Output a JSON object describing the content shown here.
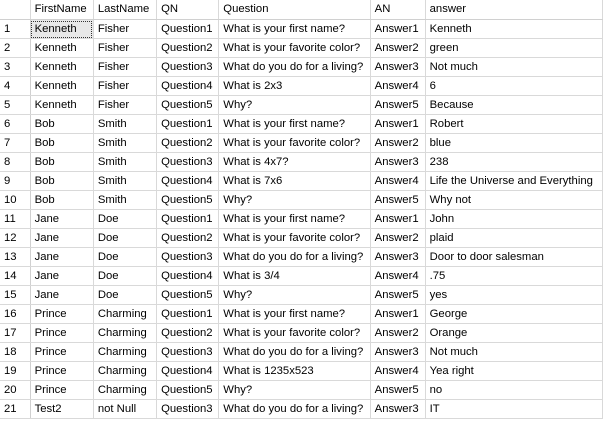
{
  "results_grid": {
    "columns": [
      "FirstName",
      "LastName",
      "QN",
      "Question",
      "AN",
      "answer"
    ],
    "rows": [
      {
        "num": "1",
        "cells": [
          "Kenneth",
          "Fisher",
          "Question1",
          "What is your first name?",
          "Answer1",
          "Kenneth"
        ]
      },
      {
        "num": "2",
        "cells": [
          "Kenneth",
          "Fisher",
          "Question2",
          "What is your favorite color?",
          "Answer2",
          "green"
        ]
      },
      {
        "num": "3",
        "cells": [
          "Kenneth",
          "Fisher",
          "Question3",
          "What do you do for a living?",
          "Answer3",
          "Not much"
        ]
      },
      {
        "num": "4",
        "cells": [
          "Kenneth",
          "Fisher",
          "Question4",
          "What is 2x3",
          "Answer4",
          "6"
        ]
      },
      {
        "num": "5",
        "cells": [
          "Kenneth",
          "Fisher",
          "Question5",
          "Why?",
          "Answer5",
          "Because"
        ]
      },
      {
        "num": "6",
        "cells": [
          "Bob",
          "Smith",
          "Question1",
          "What is your first name?",
          "Answer1",
          "Robert"
        ]
      },
      {
        "num": "7",
        "cells": [
          "Bob",
          "Smith",
          "Question2",
          "What is your favorite color?",
          "Answer2",
          "blue"
        ]
      },
      {
        "num": "8",
        "cells": [
          "Bob",
          "Smith",
          "Question3",
          "What is 4x7?",
          "Answer3",
          "238"
        ]
      },
      {
        "num": "9",
        "cells": [
          "Bob",
          "Smith",
          "Question4",
          "What is 7x6",
          "Answer4",
          "Life the Universe and Everything"
        ]
      },
      {
        "num": "10",
        "cells": [
          "Bob",
          "Smith",
          "Question5",
          "Why?",
          "Answer5",
          "Why not"
        ]
      },
      {
        "num": "11",
        "cells": [
          "Jane",
          "Doe",
          "Question1",
          "What is your first name?",
          "Answer1",
          "John"
        ]
      },
      {
        "num": "12",
        "cells": [
          "Jane",
          "Doe",
          "Question2",
          "What is your favorite color?",
          "Answer2",
          "plaid"
        ]
      },
      {
        "num": "13",
        "cells": [
          "Jane",
          "Doe",
          "Question3",
          "What do you do for a living?",
          "Answer3",
          "Door to door salesman"
        ]
      },
      {
        "num": "14",
        "cells": [
          "Jane",
          "Doe",
          "Question4",
          "What is 3/4",
          "Answer4",
          ".75"
        ]
      },
      {
        "num": "15",
        "cells": [
          "Jane",
          "Doe",
          "Question5",
          "Why?",
          "Answer5",
          "yes"
        ]
      },
      {
        "num": "16",
        "cells": [
          "Prince",
          "Charming",
          "Question1",
          "What is your first name?",
          "Answer1",
          "George"
        ]
      },
      {
        "num": "17",
        "cells": [
          "Prince",
          "Charming",
          "Question2",
          "What is your favorite color?",
          "Answer2",
          "Orange"
        ]
      },
      {
        "num": "18",
        "cells": [
          "Prince",
          "Charming",
          "Question3",
          "What do you do for a living?",
          "Answer3",
          "Not much"
        ]
      },
      {
        "num": "19",
        "cells": [
          "Prince",
          "Charming",
          "Question4",
          "What is 1235x523",
          "Answer4",
          "Yea right"
        ]
      },
      {
        "num": "20",
        "cells": [
          "Prince",
          "Charming",
          "Question5",
          "Why?",
          "Answer5",
          "no"
        ]
      },
      {
        "num": "21",
        "cells": [
          "Test2",
          "not Null",
          "Question3",
          "What do you do for a living?",
          "Answer3",
          "IT"
        ]
      }
    ]
  }
}
